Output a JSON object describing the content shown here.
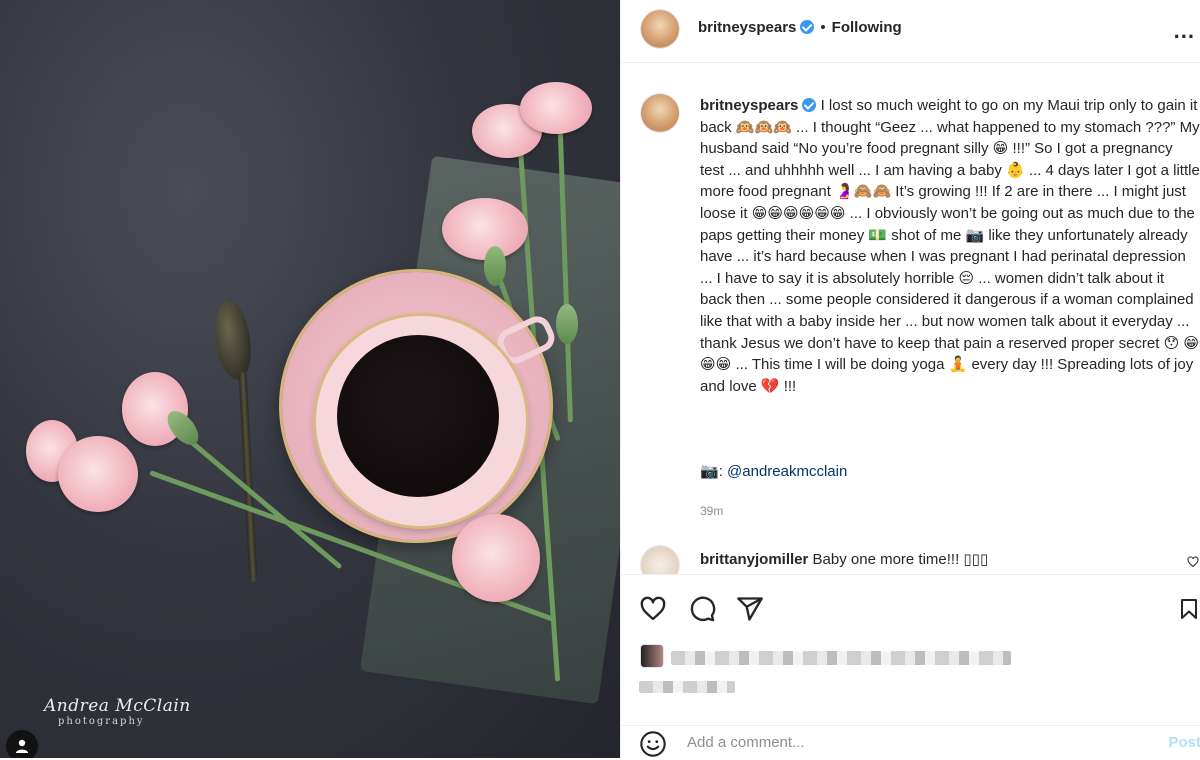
{
  "photo": {
    "watermark": "Andrea McClain",
    "watermark_sub": "photography",
    "tag_icon": "user-icon"
  },
  "header": {
    "username": "britneyspears",
    "verified_icon": "verified-badge-icon",
    "separator": "•",
    "follow_label": "Following",
    "more_label": "..."
  },
  "caption": {
    "username": "britneyspears",
    "text": "I lost so much weight to go on my Maui trip only to gain it back 🙉🙉🙉 ... I thought “Geez ... what happened to my stomach ???” My husband said “No you’re food pregnant silly 😁 !!!” So I got a pregnancy test ... and uhhhhh well ... I am having a baby 👶 ... 4 days later I got a little more food pregnant 🤰🙈🙈 It’s growing !!! If 2 are in there ... I might just loose it 😁😁😁😁😁😁 ... I obviously won’t be going out as much due to the paps getting their money 💵 shot of me 📷 like they unfortunately already have ... it’s hard because when I was pregnant I had perinatal depression ... I have to say it is absolutely horrible 😔 ... women didn’t talk about it back then ... some people considered it dangerous if a woman complained like that with a baby inside her ... but now women talk about it everyday ... thank Jesus we don’t have to keep that pain a reserved proper secret 😯 😁😁😁 ... This time I will be doing yoga 🧘 every day !!! Spreading lots of joy and love 💔 !!!",
    "credit_icon": "📷",
    "credit_label": ":",
    "credit_handle": "@andreakmcclain",
    "timestamp": "39m"
  },
  "comment": {
    "username": "brittanyjomiller",
    "text": "Baby one more time!!! ▯▯▯"
  },
  "actions": {
    "like_icon": "heart-icon",
    "comment_icon": "comment-icon",
    "share_icon": "share-icon",
    "save_icon": "bookmark-icon"
  },
  "add_comment": {
    "emoji_icon": "smiley-icon",
    "placeholder": "Add a comment...",
    "post_label": "Post"
  },
  "colors": {
    "verified": "#3897f0",
    "link": "#00376b",
    "muted": "#8e8e8e",
    "post_disabled": "#b2dffc"
  }
}
